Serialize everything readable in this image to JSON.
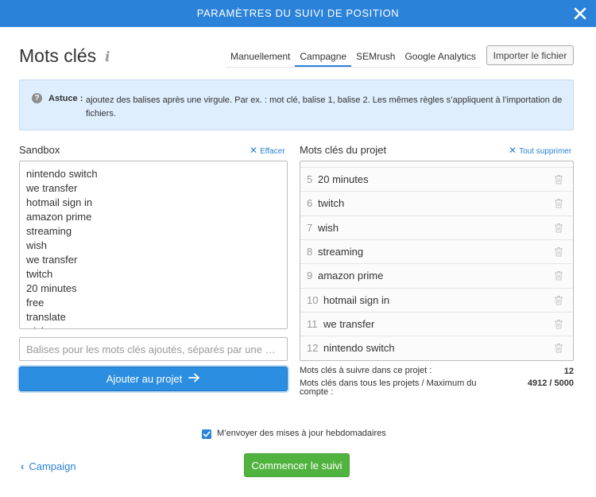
{
  "header": {
    "title": "PARAMÈTRES DU SUIVI DE POSITION"
  },
  "page": {
    "title": "Mots clés",
    "info_icon": "i"
  },
  "tabs": [
    {
      "label": "Manuellement",
      "active": false
    },
    {
      "label": "Campagne",
      "active": true
    },
    {
      "label": "SEMrush",
      "active": false
    },
    {
      "label": "Google Analytics",
      "active": false
    }
  ],
  "import_button": "Importer le fichier",
  "tip": {
    "icon": "?",
    "label": "Astuce :",
    "text": "ajoutez des balises après une virgule. Par ex. : mot clé, balise 1, balise 2. Les mêmes règles s’appliquent à l’importation de fichiers."
  },
  "sandbox": {
    "title": "Sandbox",
    "clear_link": "Effacer",
    "lines": [
      "nintendo switch",
      "we transfer",
      "hotmail sign in",
      "amazon prime",
      "streaming",
      "wish",
      "we transfer",
      "twitch",
      "20 minutes",
      "free",
      "translate",
      "wish"
    ],
    "tags_placeholder": "Balises pour les mots clés ajoutés, séparés par une …",
    "add_button": "Ajouter au projet"
  },
  "project": {
    "title": "Mots clés du projet",
    "delete_all_link": "Tout supprimer",
    "keywords": [
      {
        "num": "5",
        "text": "20 minutes"
      },
      {
        "num": "6",
        "text": "twitch"
      },
      {
        "num": "7",
        "text": "wish"
      },
      {
        "num": "8",
        "text": "streaming"
      },
      {
        "num": "9",
        "text": "amazon prime"
      },
      {
        "num": "10",
        "text": "hotmail sign in"
      },
      {
        "num": "11",
        "text": "we transfer"
      },
      {
        "num": "12",
        "text": "nintendo switch"
      }
    ],
    "stats": {
      "tracked_label": "Mots clés à suivre dans ce projet :",
      "tracked_value": "12",
      "all_label": "Mots clés dans tous les projets / Maximum du compte :",
      "all_value": "4912 / 5000"
    }
  },
  "weekly_updates": {
    "label": "M’envoyer des mises à jour hebdomadaires",
    "checked": true
  },
  "footer": {
    "back_link": "Campaign",
    "start_button": "Commencer le suivi"
  },
  "colors": {
    "header": "#2b82d9",
    "accent": "#2b82d9",
    "success": "#51b33f",
    "tip_bg": "#deeefc"
  }
}
